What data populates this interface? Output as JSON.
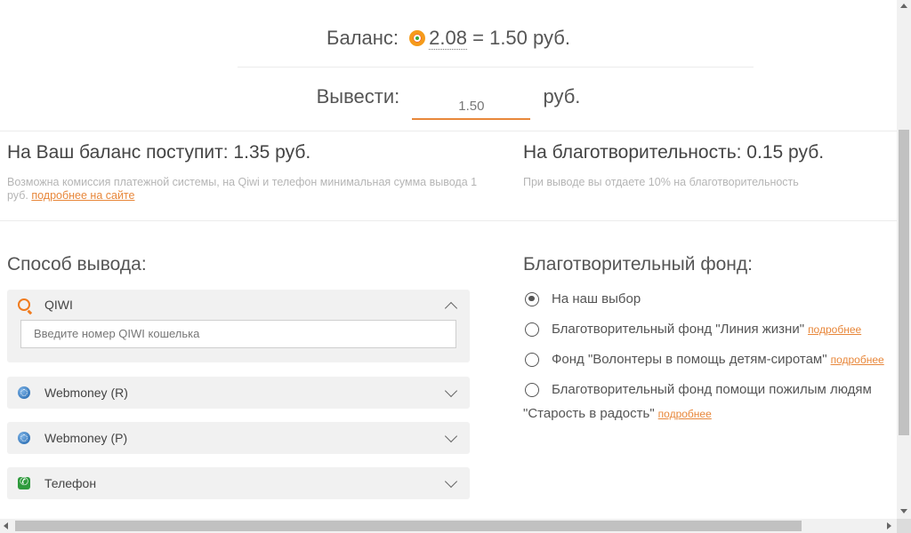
{
  "balance": {
    "label": "Баланс:",
    "coins": "2.08",
    "equals": "= 1.50 руб."
  },
  "withdraw": {
    "label": "Вывести:",
    "value": "1.50",
    "currency": "руб."
  },
  "summary": {
    "receive_title": "На Ваш баланс поступит: 1.35 руб.",
    "receive_note": "Возможна комиссия платежной системы, на Qiwi и телефон минимальная сумма вывода 1 руб.",
    "receive_link": "подробнее на сайте",
    "charity_title": "На благотворительность: 0.15 руб.",
    "charity_note": "При выводе вы отдаете 10% на благотворительность"
  },
  "methods": {
    "title": "Способ вывода:",
    "items": [
      {
        "label": "QIWI",
        "icon": "qiwi-icon",
        "expanded": true,
        "placeholder": "Введите номер QIWI кошелька"
      },
      {
        "label": "Webmoney (R)",
        "icon": "webmoney-icon",
        "expanded": false
      },
      {
        "label": "Webmoney (P)",
        "icon": "webmoney-icon",
        "expanded": false
      },
      {
        "label": "Телефон",
        "icon": "phone-icon",
        "expanded": false
      }
    ]
  },
  "charity": {
    "title": "Благотворительный фонд:",
    "more_label": "подробнее",
    "options": [
      {
        "label": "На наш выбор",
        "checked": true
      },
      {
        "label": "Благотворительный фонд \"Линия жизни\"",
        "checked": false
      },
      {
        "label": "Фонд \"Волонтеры в помощь детям-сиротам\"",
        "checked": false
      },
      {
        "label": "Благотворительный фонд помощи пожилым людям",
        "label_cont": "\"Старость в радость\"",
        "checked": false
      }
    ]
  },
  "colors": {
    "accent": "#e8873a",
    "text": "#555555",
    "muted": "#b5b5b5",
    "panel": "#f1f1f1"
  }
}
